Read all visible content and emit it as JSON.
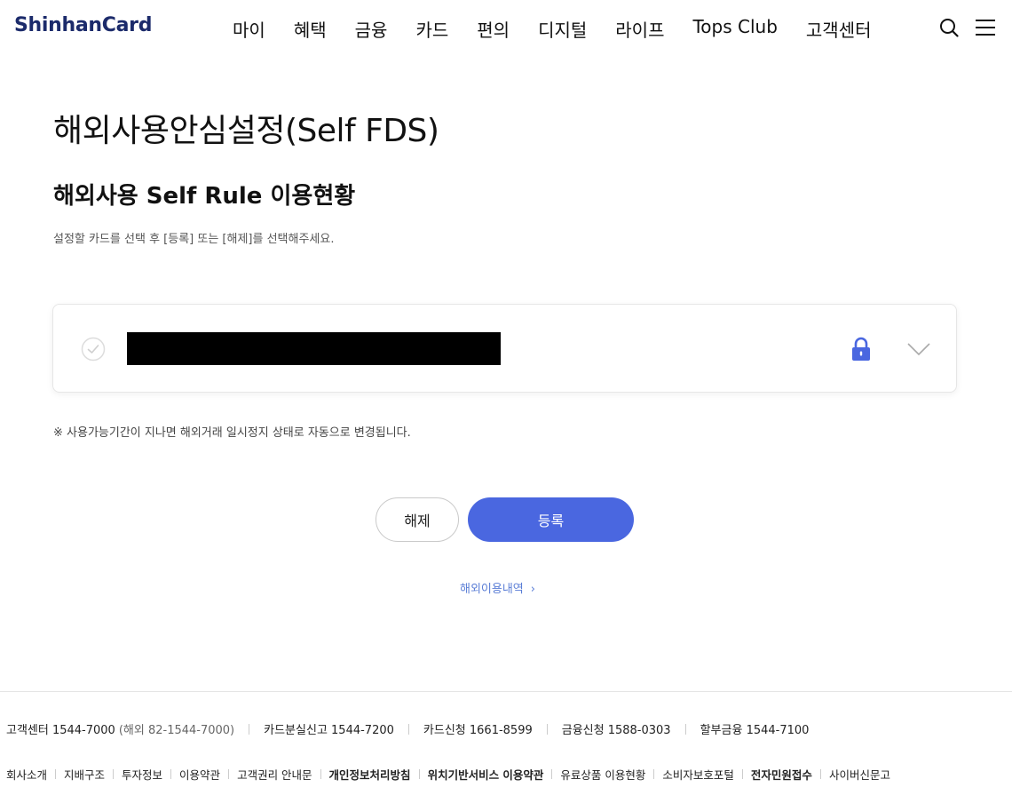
{
  "header": {
    "logo": "ShinhanCard",
    "nav": [
      "마이",
      "혜택",
      "금융",
      "카드",
      "편의",
      "디지털",
      "라이프",
      "Tops Club",
      "고객센터"
    ]
  },
  "main": {
    "title": "해외사용안심설정(Self FDS)",
    "subtitle": "해외사용 Self Rule 이용현황",
    "description": "설정할 카드를 선택 후 [등록] 또는 [해제]를 선택해주세요.",
    "notice": "※  사용가능기간이 지나면 해외거래 일시정지 상태로 자동으로 변경됩니다.",
    "release_button": "해제",
    "register_button": "등록",
    "history_link": "해외이용내역",
    "history_arrow": "›"
  },
  "footer": {
    "contacts": [
      {
        "label": "고객센터 1544-7000",
        "extra": "(해외 82-1544-7000)"
      },
      {
        "label": "카드분실신고 1544-7200",
        "extra": ""
      },
      {
        "label": "카드신청 1661-8599",
        "extra": ""
      },
      {
        "label": "금융신청 1588-0303",
        "extra": ""
      },
      {
        "label": "할부금융 1544-7100",
        "extra": ""
      }
    ],
    "links": [
      {
        "label": "회사소개",
        "bold": false
      },
      {
        "label": "지배구조",
        "bold": false
      },
      {
        "label": "투자정보",
        "bold": false
      },
      {
        "label": "이용약관",
        "bold": false
      },
      {
        "label": "고객권리 안내문",
        "bold": false
      },
      {
        "label": "개인정보처리방침",
        "bold": true
      },
      {
        "label": "위치기반서비스 이용약관",
        "bold": true
      },
      {
        "label": "유료상품 이용현황",
        "bold": false
      },
      {
        "label": "소비자보호포털",
        "bold": false
      },
      {
        "label": "전자민원접수",
        "bold": true
      },
      {
        "label": "사이버신문고",
        "bold": false
      }
    ]
  },
  "colors": {
    "accent": "#4a67e0",
    "logo": "#1c2b6b",
    "link": "#5b7ed6"
  },
  "icons": [
    "search-icon",
    "menu-icon",
    "check-icon",
    "lock-icon",
    "chevron-down-icon"
  ]
}
